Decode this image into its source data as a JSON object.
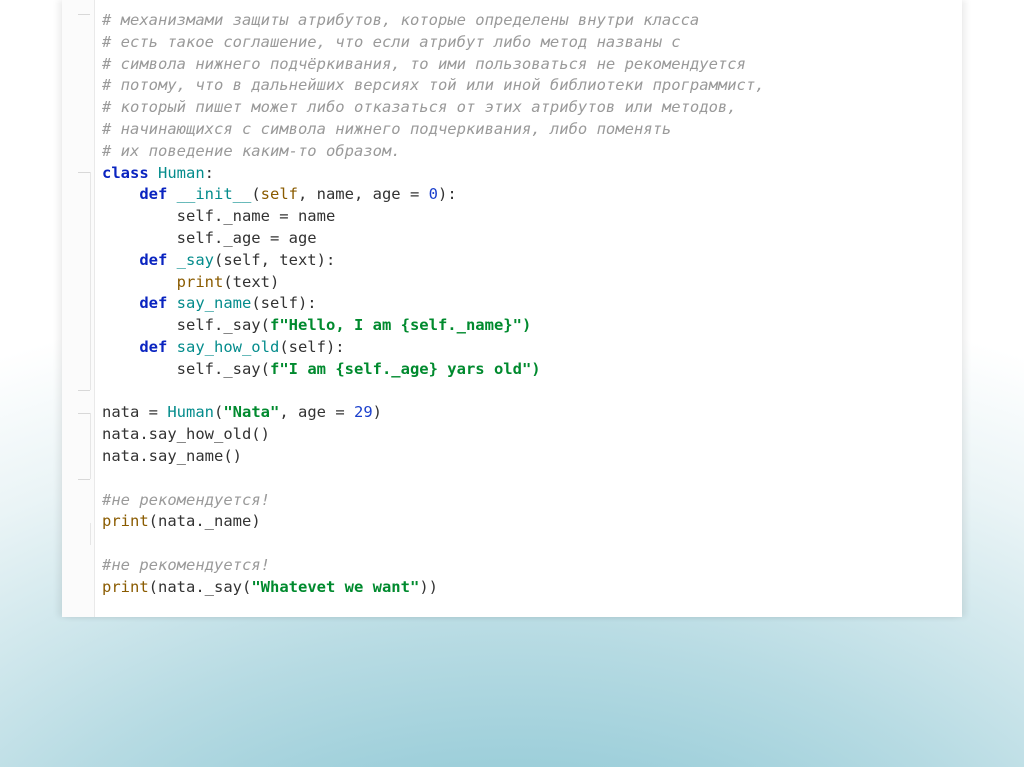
{
  "code": {
    "comments": [
      "# механизмами защиты атрибутов, которые определены внутри класса",
      "# есть такое соглашение, что если атрибут либо метод названы с",
      "# символа нижнего подчёркивания, то ими пользоваться не рекомендуется",
      "# потому, что в дальнейших версиях той или иной библиотеки программист,",
      "# который пишет может либо отказаться от этих атрибутов или методов,",
      "# начинающихся с символа нижнего подчеркивания, либо поменять",
      "# их поведение каким-то образом."
    ],
    "class_kw": "class ",
    "class_name": "Human",
    "def_kw": "def ",
    "self_kw": "self",
    "init_name": "__init__",
    "init_params_open": "(",
    "init_params_mid": ", name, age = ",
    "zero": "0",
    "close_paren_colon": "):",
    "assign_name": "self._name = name",
    "assign_age": "self._age = age",
    "say_name_priv": "_say",
    "say_params": "(self, text):",
    "print_call_open": "print",
    "print_call_args": "(text)",
    "say_name_pub": "say_name",
    "self_only_params": "(self):",
    "say_name_body_prefix": "self._say(",
    "say_name_body_fprefix": "f\"",
    "say_name_body_str": "Hello, I am {self._name}",
    "say_name_body_close": "\")",
    "say_how_old_name": "say_how_old",
    "say_how_old_body_prefix": "self._say(",
    "say_how_old_body_fprefix": "f\"",
    "say_how_old_body_str": "I am {self._age} yars old",
    "say_how_old_body_close": "\")",
    "nata_assign_left": "nata = ",
    "human_ctor": "Human",
    "nata_ctor_open": "(",
    "nata_str": "\"Nata\"",
    "nata_age_kw": ", age = ",
    "twentynine": "29",
    "nata_ctor_close": ")",
    "call_say_how_old": "nata.say_how_old()",
    "call_say_name": "nata.say_name()",
    "not_recommended": "#не рекомендуется!",
    "print_nata_name_open": "print",
    "print_nata_name_args": "(nata._name)",
    "print_nata_say_open": "print",
    "print_nata_say_args_prefix": "(nata._say(",
    "whatever_str": "\"Whatevet we want\"",
    "print_nata_say_args_close": "))"
  }
}
